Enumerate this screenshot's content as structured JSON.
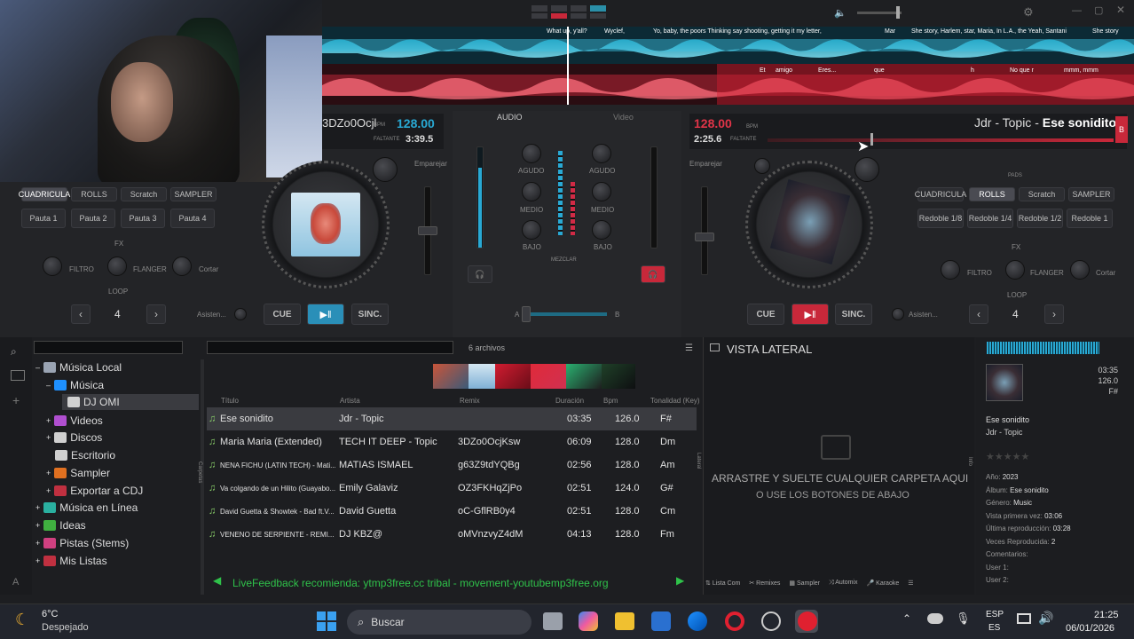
{
  "deck_left": {
    "title_fragment": "3DZo0Ocjl",
    "bpm": "128.00",
    "bpm_label": "BPM",
    "remaining_label": "FALTANTE",
    "remaining": "3:39.5",
    "sync_btn": "Emparejar",
    "cue": "CUE",
    "sinc": "SINC.",
    "loop_value": "4",
    "loop_label": "LOOP",
    "assist": "Asisten...",
    "pads": [
      "CUADRICULA",
      "ROLLS",
      "Scratch",
      "SAMPLER"
    ],
    "pad_buttons": [
      "Pauta 1",
      "Pauta 2",
      "Pauta 3",
      "Pauta 4"
    ],
    "fx_label": "FX",
    "fx": [
      "FILTRO",
      "FLANGER",
      "Cortar"
    ]
  },
  "deck_right": {
    "artist": "Jdr - Topic",
    "separator": " - ",
    "song": "Ese sonidito",
    "bpm": "128.00",
    "bpm_label": "BPM",
    "remaining_label": "FALTANTE",
    "remaining": "2:25.6",
    "deck_letter": "B",
    "sync_btn": "Emparejar",
    "cue": "CUE",
    "sinc": "SINC.",
    "loop_value": "4",
    "loop_label": "LOOP",
    "assist": "Asisten...",
    "pads_label": "PADS",
    "pads": [
      "CUADRICULA",
      "ROLLS",
      "Scratch",
      "SAMPLER"
    ],
    "pad_buttons": [
      "Redoble 1/8",
      "Redoble 1/4",
      "Redoble 1/2",
      "Redoble 1"
    ],
    "fx_label": "FX",
    "fx": [
      "FILTRO",
      "FLANGER",
      "Cortar"
    ]
  },
  "mixer": {
    "tab_audio": "AUDIO",
    "tab_video": "Video",
    "agudo": "AGUDO",
    "medio": "MEDIO",
    "bajo": "BAJO",
    "mezclar": "MEZCLAR",
    "a": "A",
    "b": "B"
  },
  "lyrics_top": [
    "What up, y'all?",
    "Wyclef,",
    "Yo, baby, the poors Thinking say shooting, getting it my letter,",
    "Mar",
    "She story, Harlem, star, Maria, In L.A., the Yeah, Santani",
    "She story"
  ],
  "lyrics_bottom": [
    "Et",
    "amigo",
    "Eres...",
    "que",
    "h",
    "No que r",
    "mmm, mmm"
  ],
  "browser": {
    "file_count": "6 archivos",
    "side_panel_title": "VISTA LATERAL",
    "drop_line1": "ARRASTRE Y SUELTE CUALQUIER CARPETA AQUI",
    "drop_line2": "O USE LOS BOTONES DE ABAJO",
    "tree": [
      {
        "label": "Música Local",
        "color": "#9aa4b3"
      },
      {
        "label": "Música",
        "color": "#1e90ff"
      },
      {
        "label": "DJ OMI",
        "color": "#d0d0d0"
      },
      {
        "label": "Videos",
        "color": "#b04fd0"
      },
      {
        "label": "Discos",
        "color": "#d0d0d0"
      },
      {
        "label": "Escritorio",
        "color": "#d0d0d0"
      },
      {
        "label": "Sampler",
        "color": "#e07020"
      },
      {
        "label": "Exportar a CDJ",
        "color": "#c03040"
      },
      {
        "label": "Música en Línea",
        "color": "#2ab0a0"
      },
      {
        "label": "Ideas",
        "color": "#40b040"
      },
      {
        "label": "Pistas (Stems)",
        "color": "#d04080"
      },
      {
        "label": "Mis Listas",
        "color": "#c03040"
      }
    ],
    "columns": [
      "Título",
      "Artista",
      "Remix",
      "Duración",
      "Bpm",
      "Tonalidad (Key)"
    ],
    "rows": [
      {
        "title": "Ese sonidito",
        "artist": "Jdr - Topic",
        "remix": "",
        "duration": "03:35",
        "bpm": "126.0",
        "key": "F#"
      },
      {
        "title": "Maria Maria (Extended)",
        "artist": "TECH IT DEEP - Topic",
        "remix": "3DZo0OcjKsw",
        "duration": "06:09",
        "bpm": "128.0",
        "key": "Dm"
      },
      {
        "title": "NENA FICHU (LATIN TECH) - Mati...",
        "artist": "MATIAS ISMAEL",
        "remix": "g63Z9tdYQBg",
        "duration": "02:56",
        "bpm": "128.0",
        "key": "Am"
      },
      {
        "title": "Va colgando de un Hilito (Guayabo...",
        "artist": "Emily Galaviz",
        "remix": "OZ3FKHqZjPo",
        "duration": "02:51",
        "bpm": "124.0",
        "key": "G#"
      },
      {
        "title": "David Guetta & Showtek - Bad ft.V...",
        "artist": "David Guetta",
        "remix": "oC-GflRB0y4",
        "duration": "02:51",
        "bpm": "128.0",
        "key": "Cm"
      },
      {
        "title": "VENENO DE SERPIENTE - REMI...",
        "artist": "DJ KBZ@",
        "remix": "oMVnzvyZ4dM",
        "duration": "04:13",
        "bpm": "128.0",
        "key": "Fm"
      }
    ],
    "recommendation": "LiveFeedback recomienda: ytmp3free.cc tribal - movement-youtubemp3free.org",
    "bottom_tabs": [
      "Lista Com",
      "Remixes",
      "Sampler",
      "Automix",
      "Karaoke"
    ],
    "side_tab_left": "Carpetas",
    "side_tab_mid": "Lateral",
    "side_tab_right": "Info"
  },
  "info": {
    "duration": "03:35",
    "bpm": "126.0",
    "key": "F#",
    "title": "Ese sonidito",
    "artist": "Jdr - Topic",
    "year_label": "Año:",
    "year": "2023",
    "album_label": "Álbum:",
    "album": "Ese sonidito",
    "genre_label": "Género:",
    "genre": "Music",
    "first_seen_label": "Vista primera vez:",
    "first_seen": "03:06",
    "last_play_label": "Última reproducción:",
    "last_play": "03:28",
    "plays_label": "Veces Reproducida:",
    "plays": "2",
    "comments_label": "Comentarios:",
    "user1": "User 1:",
    "user2": "User 2:"
  },
  "taskbar": {
    "temp": "6°C",
    "weather": "Despejado",
    "search": "Buscar",
    "lang1": "ESP",
    "lang2": "ES",
    "time": "21:25",
    "date": "06/01/2026"
  }
}
